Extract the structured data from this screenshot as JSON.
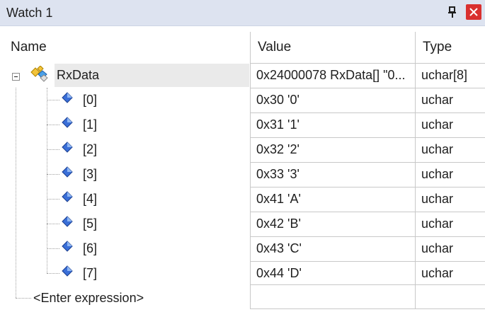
{
  "window": {
    "title": "Watch 1"
  },
  "columns": {
    "name": "Name",
    "value": "Value",
    "type": "Type"
  },
  "root": {
    "name": "RxData",
    "value": "0x24000078 RxData[] \"0...",
    "type": "uchar[8]"
  },
  "items": [
    {
      "name": "[0]",
      "value": "0x30 '0'",
      "type": "uchar"
    },
    {
      "name": "[1]",
      "value": "0x31 '1'",
      "type": "uchar"
    },
    {
      "name": "[2]",
      "value": "0x32 '2'",
      "type": "uchar"
    },
    {
      "name": "[3]",
      "value": "0x33 '3'",
      "type": "uchar"
    },
    {
      "name": "[4]",
      "value": "0x41 'A'",
      "type": "uchar"
    },
    {
      "name": "[5]",
      "value": "0x42 'B'",
      "type": "uchar"
    },
    {
      "name": "[6]",
      "value": "0x43 'C'",
      "type": "uchar"
    },
    {
      "name": "[7]",
      "value": "0x44 'D'",
      "type": "uchar"
    }
  ],
  "enter_expression": "<Enter expression>",
  "icons": {
    "pin": "pin-icon",
    "close": "close-icon",
    "collapse": "collapse-minus-icon",
    "root": "variable-icon",
    "element": "element-icon"
  },
  "colors": {
    "titlebar": "#dde3f0",
    "close": "#d9302f",
    "element_icon": "#3a6fd8"
  }
}
